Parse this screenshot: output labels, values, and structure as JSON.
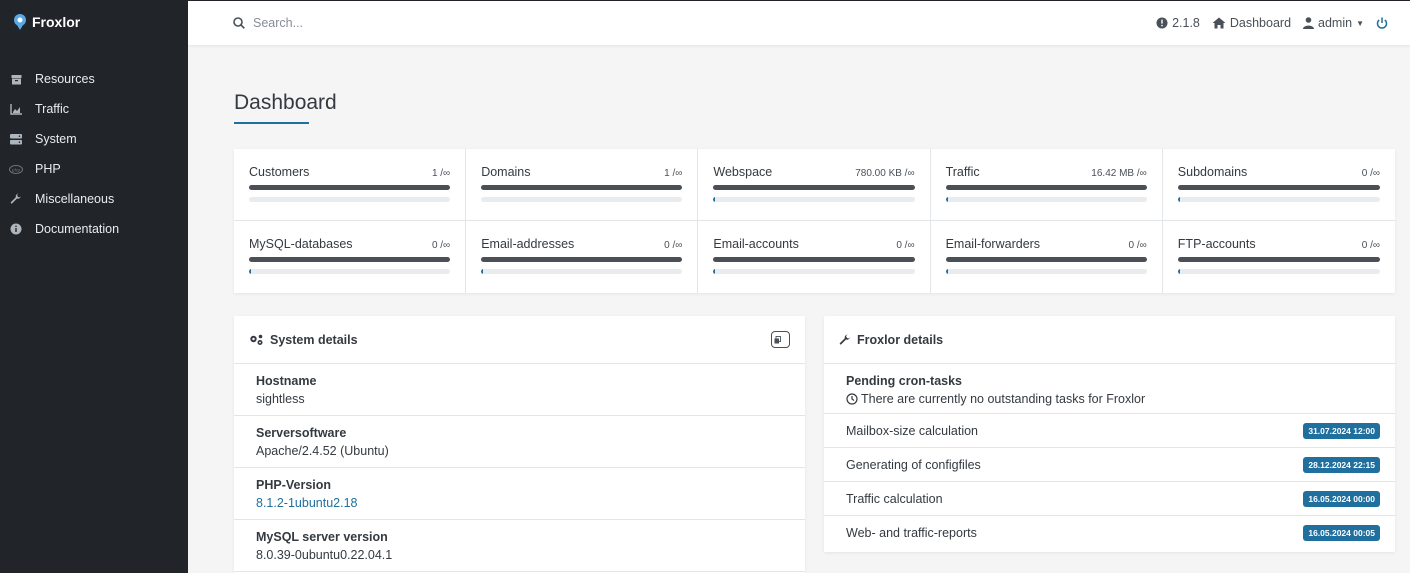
{
  "brand": {
    "name": "Froxlor"
  },
  "sidebar": {
    "items": [
      {
        "label": "Resources",
        "icon": "resources-icon"
      },
      {
        "label": "Traffic",
        "icon": "chart-icon"
      },
      {
        "label": "System",
        "icon": "server-icon"
      },
      {
        "label": "PHP",
        "icon": "php-icon"
      },
      {
        "label": "Miscellaneous",
        "icon": "wrench-icon"
      },
      {
        "label": "Documentation",
        "icon": "info-icon"
      }
    ]
  },
  "topbar": {
    "search_placeholder": "Search...",
    "version": "2.1.8",
    "dashboard_label": "Dashboard",
    "user_label": "admin"
  },
  "page": {
    "title": "Dashboard"
  },
  "stats": [
    {
      "label": "Customers",
      "value": "1 /∞",
      "fill": 0
    },
    {
      "label": "Domains",
      "value": "1 /∞",
      "fill": 0
    },
    {
      "label": "Webspace",
      "value": "780.00 KB /∞",
      "fill": 0.01
    },
    {
      "label": "Traffic",
      "value": "16.42 MB /∞",
      "fill": 0.01
    },
    {
      "label": "Subdomains",
      "value": "0 /∞",
      "fill": 0.01
    },
    {
      "label": "MySQL-databases",
      "value": "0 /∞",
      "fill": 0.01
    },
    {
      "label": "Email-addresses",
      "value": "0 /∞",
      "fill": 0.01
    },
    {
      "label": "Email-accounts",
      "value": "0 /∞",
      "fill": 0.01
    },
    {
      "label": "Email-forwarders",
      "value": "0 /∞",
      "fill": 0.01
    },
    {
      "label": "FTP-accounts",
      "value": "0 /∞",
      "fill": 0.01
    }
  ],
  "system_details": {
    "title": "System details",
    "rows": [
      {
        "label": "Hostname",
        "value": "sightless"
      },
      {
        "label": "Serversoftware",
        "value": "Apache/2.4.52 (Ubuntu)"
      },
      {
        "label": "PHP-Version",
        "value": "8.1.2-1ubuntu2.18"
      },
      {
        "label": "MySQL server version",
        "value": "8.0.39-0ubuntu0.22.04.1"
      }
    ]
  },
  "froxlor_details": {
    "title": "Froxlor details",
    "pending_label": "Pending cron-tasks",
    "pending_value": "There are currently no outstanding tasks for Froxlor",
    "rows": [
      {
        "label": "Mailbox-size calculation",
        "badge": "31.07.2024 12:00"
      },
      {
        "label": "Generating of configfiles",
        "badge": "28.12.2024 22:15"
      },
      {
        "label": "Traffic calculation",
        "badge": "16.05.2024 00:00"
      },
      {
        "label": "Web- and traffic-reports",
        "badge": "16.05.2024 00:05"
      }
    ]
  }
}
